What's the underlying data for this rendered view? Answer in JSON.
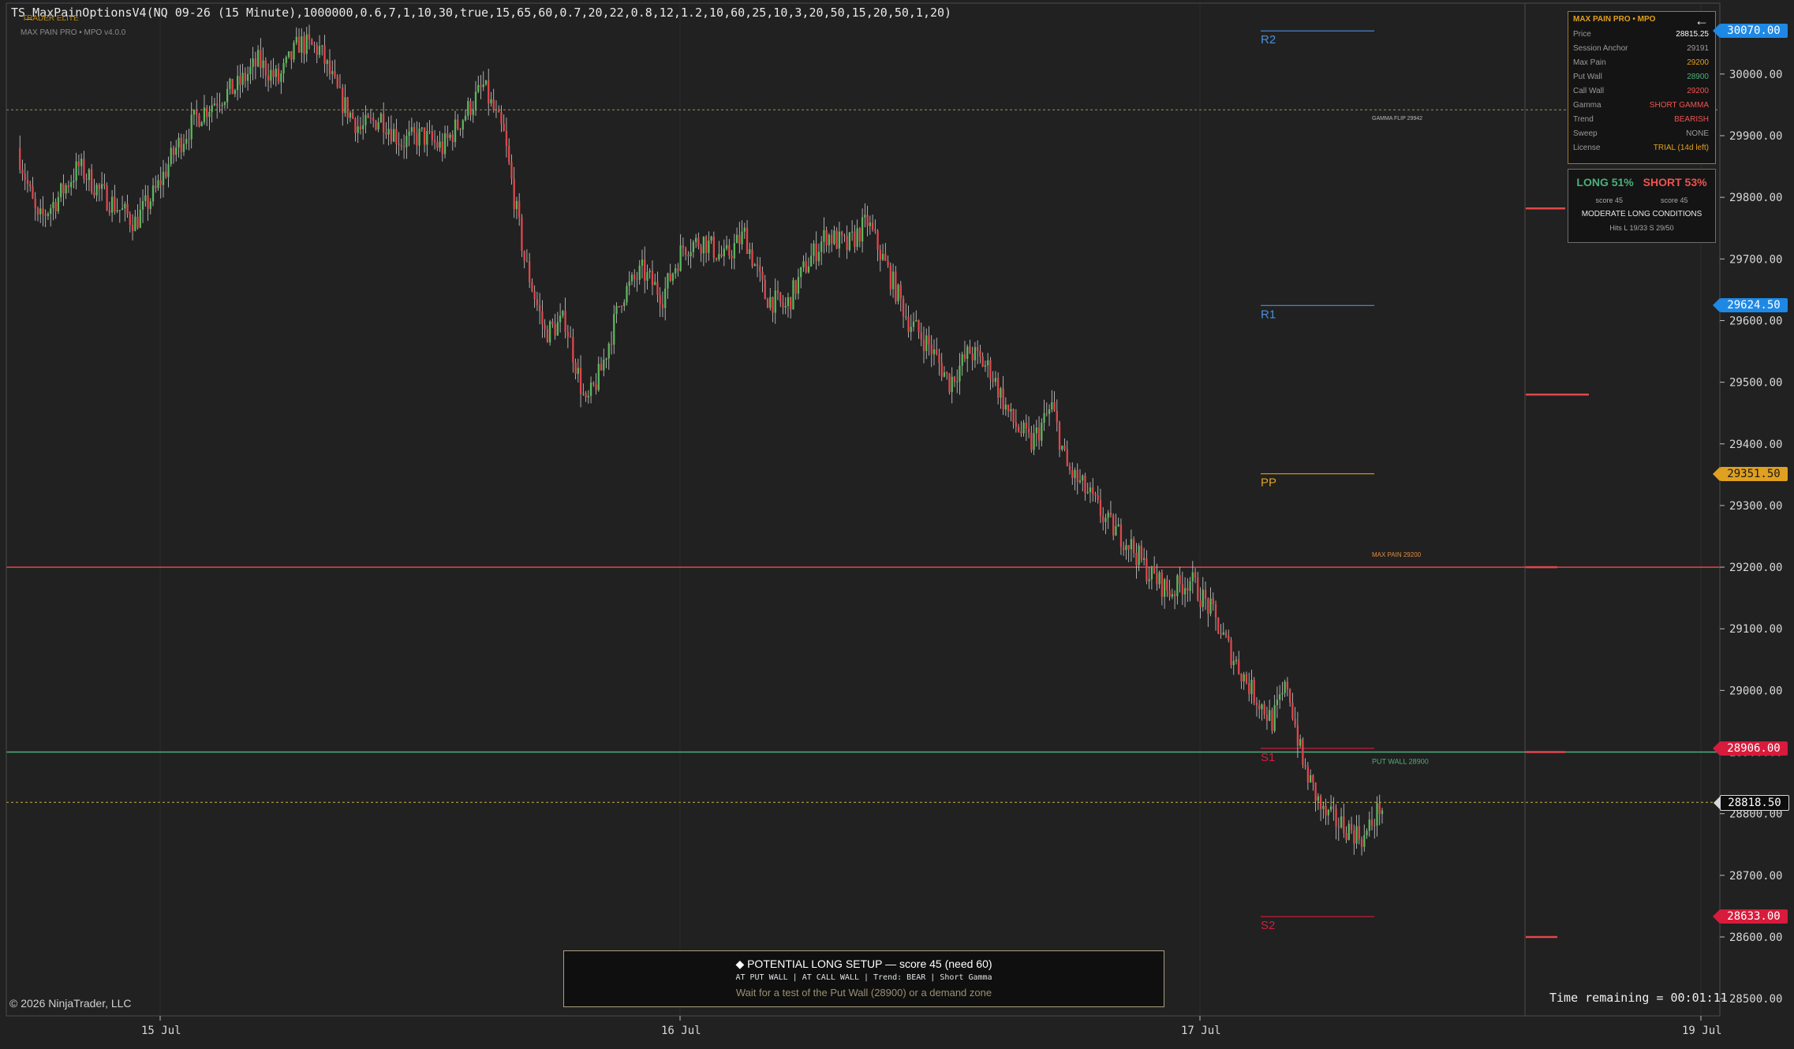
{
  "header": {
    "indicator_title": "TS_MaxPainOptionsV4(NQ 09-26 (15 Minute),1000000,0.6,7,1,10,30,true,15,65,60,0.7,20,22,0.8,12,1.2,10,60,25,10,3,20,50,15,20,50,1,20)",
    "subtitle": "MAX PAIN PRO  •  MPO v4.0.0",
    "watermark": "TRADER ELITE"
  },
  "footer": {
    "copyright": "© 2026 NinjaTrader, LLC",
    "time_remaining": "Time remaining = 00:01:11"
  },
  "info_panel": {
    "title": "MAX PAIN PRO  •  MPO",
    "back_icon": "arrow-left-icon",
    "rows": [
      {
        "key": "Price",
        "value": "28815.25",
        "color": "#ffffff"
      },
      {
        "key": "Session Anchor",
        "value": "29191",
        "color": "#9a9a9a"
      },
      {
        "key": "Max Pain",
        "value": "29200",
        "color": "#e0a020"
      },
      {
        "key": "Put Wall",
        "value": "28900",
        "color": "#4caf7c"
      },
      {
        "key": "Call Wall",
        "value": "29200",
        "color": "#ef5350"
      },
      {
        "key": "Gamma",
        "value": "SHORT GAMMA",
        "color": "#ef5350"
      },
      {
        "key": "Trend",
        "value": "BEARISH",
        "color": "#ef5350"
      },
      {
        "key": "Sweep",
        "value": "NONE",
        "color": "#9a9a9a"
      },
      {
        "key": "License",
        "value": "TRIAL (14d left)",
        "color": "#e0a020"
      }
    ]
  },
  "score_panel": {
    "long_label": "LONG 51%",
    "short_label": "SHORT 53%",
    "long_score": "score 45",
    "short_score": "score 45",
    "condition": "MODERATE LONG CONDITIONS",
    "hits": "Hits  L 19/33    S 29/50"
  },
  "setup_box": {
    "title": "◆ POTENTIAL LONG SETUP — score 45 (need 60)",
    "tags": "AT PUT WALL   |   AT CALL WALL   |   Trend: BEAR   |   Short Gamma",
    "note": "Wait for a test of the Put Wall (28900) or a demand zone"
  },
  "price_tags": [
    {
      "price": 30070,
      "label": "30070.00",
      "bg": "#1e88e5",
      "fg": "#ffffff"
    },
    {
      "price": 29624.5,
      "label": "29624.50",
      "bg": "#1e88e5",
      "fg": "#ffffff"
    },
    {
      "price": 29351.5,
      "label": "29351.50",
      "bg": "#e0a020",
      "fg": "#1a1a1a"
    },
    {
      "price": 28906,
      "label": "28906.00",
      "bg": "#d81b3c",
      "fg": "#ffffff"
    },
    {
      "price": 28818.5,
      "label": "28818.50",
      "bg": "#0d0d0d",
      "fg": "#ffffff"
    },
    {
      "price": 28633,
      "label": "28633.00",
      "bg": "#d81b3c",
      "fg": "#ffffff"
    }
  ],
  "colors": {
    "background": "#212121",
    "bull": "#5cb85c",
    "bear": "#e0474c",
    "grid": "#2c2c2c",
    "axis_text": "#d8d8d8"
  },
  "chart_data": {
    "type": "candlestick",
    "instrument": "NQ 09-26",
    "interval": "15 Minute",
    "ylim": [
      28450,
      30120
    ],
    "y_ticks": [
      28500,
      28600,
      28700,
      28800,
      28900,
      29000,
      29100,
      29200,
      29300,
      29400,
      29500,
      29600,
      29700,
      29800,
      29900,
      30000
    ],
    "y_tick_labels": [
      "28500.00",
      "28600.00",
      "28700.00",
      "28800.00",
      "28900.00",
      "29000.00",
      "29100.00",
      "29200.00",
      "29300.00",
      "29400.00",
      "29500.00",
      "29600.00",
      "29700.00",
      "29800.00",
      "29900.00",
      "30000.00"
    ],
    "x_ticks": [
      "15 Jul",
      "16 Jul",
      "17 Jul",
      "19 Jul"
    ],
    "close_path": [
      [
        0,
        29880
      ],
      [
        8,
        29760
      ],
      [
        16,
        29800
      ],
      [
        24,
        29850
      ],
      [
        32,
        29810
      ],
      [
        40,
        29780
      ],
      [
        46,
        29760
      ],
      [
        54,
        29810
      ],
      [
        62,
        29880
      ],
      [
        70,
        29930
      ],
      [
        78,
        29960
      ],
      [
        86,
        29980
      ],
      [
        94,
        30020
      ],
      [
        102,
        29990
      ],
      [
        110,
        30050
      ],
      [
        118,
        30040
      ],
      [
        126,
        29960
      ],
      [
        134,
        29910
      ],
      [
        142,
        29930
      ],
      [
        150,
        29890
      ],
      [
        158,
        29900
      ],
      [
        166,
        29880
      ],
      [
        174,
        29930
      ],
      [
        182,
        29980
      ],
      [
        190,
        29900
      ],
      [
        198,
        29700
      ],
      [
        206,
        29580
      ],
      [
        214,
        29600
      ],
      [
        222,
        29460
      ],
      [
        228,
        29520
      ],
      [
        236,
        29640
      ],
      [
        244,
        29680
      ],
      [
        252,
        29640
      ],
      [
        260,
        29720
      ],
      [
        268,
        29730
      ],
      [
        276,
        29700
      ],
      [
        284,
        29740
      ],
      [
        292,
        29640
      ],
      [
        300,
        29620
      ],
      [
        308,
        29690
      ],
      [
        316,
        29740
      ],
      [
        324,
        29720
      ],
      [
        332,
        29760
      ],
      [
        340,
        29680
      ],
      [
        348,
        29600
      ],
      [
        356,
        29560
      ],
      [
        364,
        29500
      ],
      [
        372,
        29550
      ],
      [
        380,
        29520
      ],
      [
        388,
        29440
      ],
      [
        396,
        29400
      ],
      [
        404,
        29460
      ],
      [
        410,
        29360
      ],
      [
        418,
        29320
      ],
      [
        426,
        29270
      ],
      [
        434,
        29240
      ],
      [
        442,
        29190
      ],
      [
        450,
        29160
      ],
      [
        458,
        29180
      ],
      [
        466,
        29130
      ],
      [
        474,
        29060
      ],
      [
        482,
        29000
      ],
      [
        490,
        28950
      ],
      [
        496,
        29010
      ],
      [
        502,
        28880
      ],
      [
        510,
        28800
      ],
      [
        518,
        28780
      ],
      [
        526,
        28760
      ],
      [
        532,
        28810
      ]
    ],
    "levels": [
      {
        "name": "R2",
        "price": 30070,
        "color": "#4a90d9",
        "label": "R2"
      },
      {
        "name": "Gamma Flip",
        "price": 29942,
        "color": "#b0a070",
        "label": "GAMMA FLIP 29942"
      },
      {
        "name": "R1",
        "price": 29624.5,
        "color": "#4a90d9",
        "label": "R1"
      },
      {
        "name": "PP",
        "price": 29351.5,
        "color": "#e0a020",
        "label": "PP"
      },
      {
        "name": "Max Pain / Call Wall",
        "price": 29200,
        "color": "#e0474c",
        "label": "MAX PAIN 29200"
      },
      {
        "name": "S1",
        "price": 28906,
        "color": "#d81b3c",
        "label": "S1"
      },
      {
        "name": "Put Wall",
        "price": 28900,
        "color": "#4caf7c",
        "label": "PUT WALL 28900"
      },
      {
        "name": "Last",
        "price": 28818.5,
        "color": "#c8b040",
        "label": ""
      },
      {
        "name": "S2",
        "price": 28633,
        "color": "#d81b3c",
        "label": "S2"
      }
    ]
  }
}
